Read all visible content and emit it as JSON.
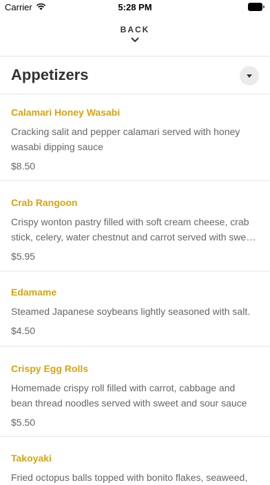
{
  "status_bar": {
    "carrier": "Carrier",
    "time": "5:28 PM"
  },
  "nav": {
    "back_label": "BACK"
  },
  "section": {
    "title": "Appetizers"
  },
  "items": [
    {
      "name": "Calamari Honey Wasabi",
      "description": "Cracking salit and pepper calamari served with honey wasabi dipping sauce",
      "price": "$8.50"
    },
    {
      "name": "Crab Rangoon",
      "description": "Crispy wonton pastry filled with soft cream cheese, crab stick, celery, water chestnut and carrot served with sweet and sour sauce",
      "price": "$5.95"
    },
    {
      "name": "Edamame",
      "description": "Steamed Japanese soybeans lightly seasoned with salt.",
      "price": "$4.50"
    },
    {
      "name": "Crispy Egg Rolls",
      "description": "Homemade crispy roll filled with carrot, cabbage and bean thread noodles served with sweet and sour sauce",
      "price": "$5.50"
    },
    {
      "name": "Takoyaki",
      "description": "Fried octopus balls topped with bonito flakes, seaweed,",
      "price": ""
    }
  ],
  "colors": {
    "item_name": "#d9a40c",
    "text": "#333333",
    "secondary_text": "#666666",
    "divider": "#e6e6e6"
  }
}
